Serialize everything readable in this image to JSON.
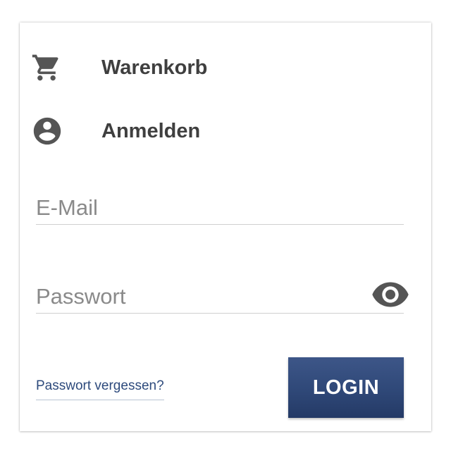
{
  "menu": {
    "cart": {
      "label": "Warenkorb",
      "icon": "shopping-cart-icon"
    },
    "login": {
      "label": "Anmelden",
      "icon": "account-circle-icon"
    }
  },
  "form": {
    "email": {
      "value": "",
      "placeholder": "E-Mail"
    },
    "password": {
      "value": "",
      "placeholder": "Passwort",
      "toggle_icon": "eye-icon"
    },
    "forgot_link": "Passwort vergessen?",
    "submit_label": "LOGIN"
  },
  "colors": {
    "icon": "#555555",
    "text": "#3f3f3f",
    "link": "#2d4a7c",
    "button": "#2f4878",
    "button_text": "#ffffff"
  }
}
